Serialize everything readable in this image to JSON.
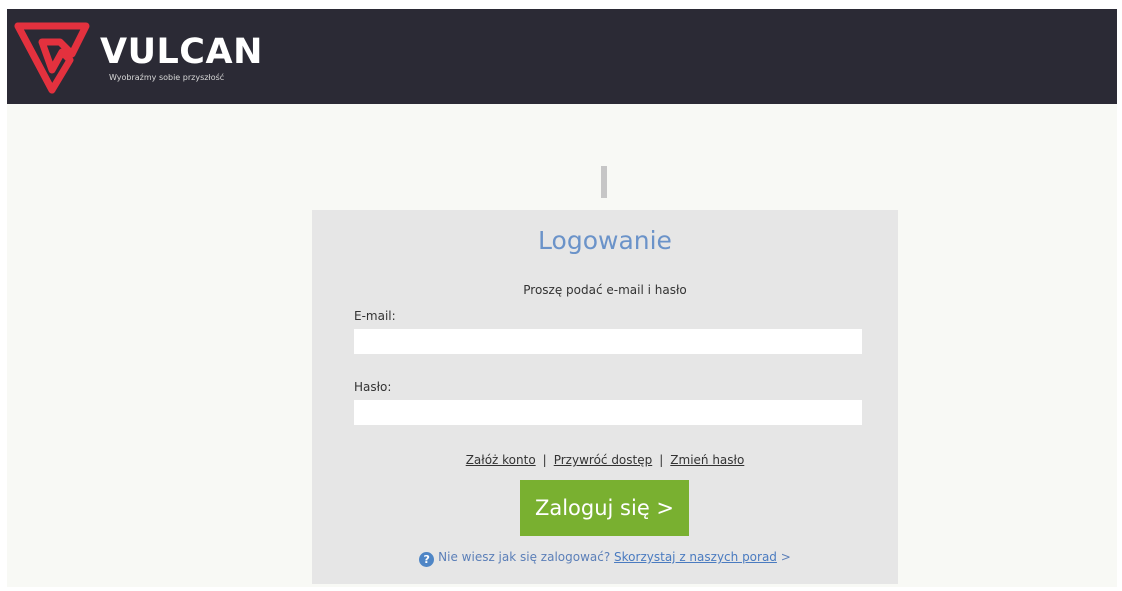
{
  "header": {
    "brand": "VULCAN",
    "tagline": "Wyobraźmy sobie przyszłość"
  },
  "login": {
    "title": "Logowanie",
    "subtitle": "Proszę podać e-mail i hasło",
    "email_label": "E-mail:",
    "email_value": "",
    "password_label": "Hasło:",
    "password_value": "",
    "links": {
      "create_account": "Załóż konto",
      "restore_access": "Przywróć dostęp",
      "change_password": "Zmień hasło",
      "separator": "|"
    },
    "submit_label": "Zaloguj się >",
    "help_text": "Nie wiesz jak się zalogować?",
    "help_link": "Skorzystaj z naszych porad",
    "help_arrow": ">"
  },
  "icons": {
    "help_icon": "?"
  },
  "colors": {
    "header_bg": "#2b2a35",
    "logo_red": "#e3313e",
    "title_blue": "#6b93c9",
    "button_green": "#79b030",
    "box_bg": "#e6e6e6"
  }
}
